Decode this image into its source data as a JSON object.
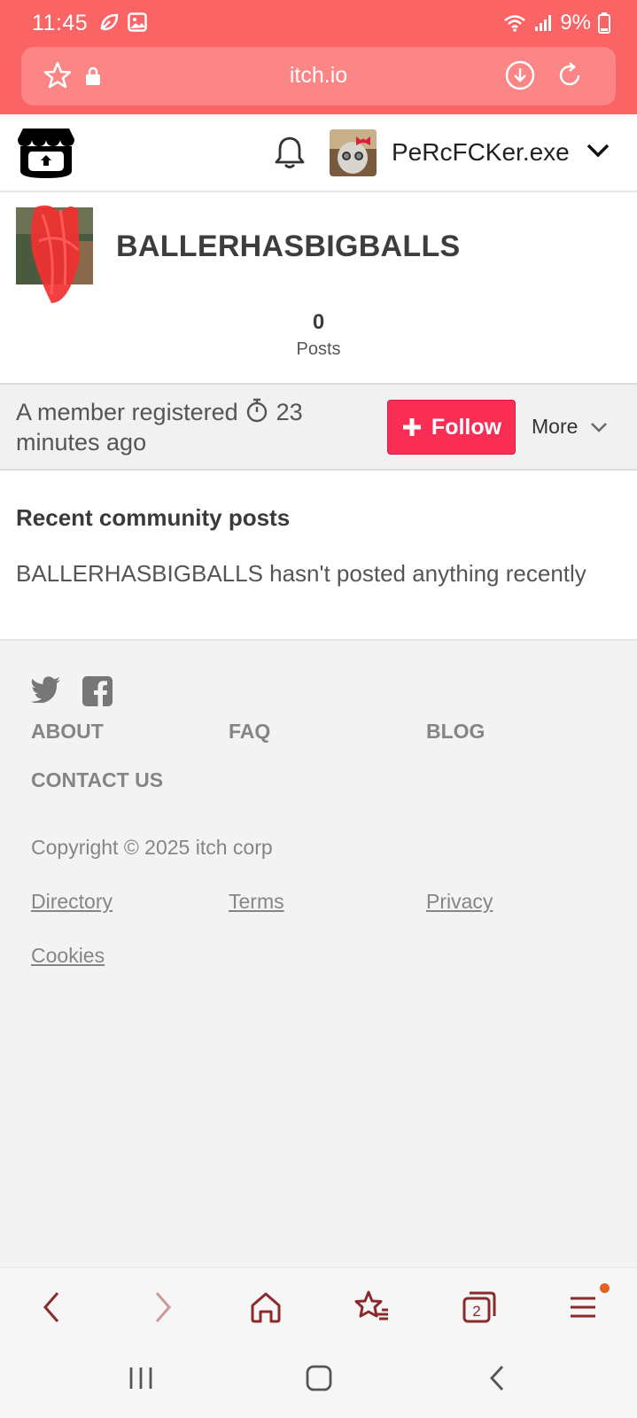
{
  "status": {
    "time": "11:45",
    "battery": "9%"
  },
  "browser": {
    "url": "itch.io"
  },
  "header": {
    "username": "PeRcFCKer.exe"
  },
  "profile": {
    "name": "BALLERHASBIGBALLS",
    "posts_count": "0",
    "posts_label": "Posts"
  },
  "member": {
    "text_a": "A member registered",
    "text_b": "23",
    "text_c": "minutes ago",
    "follow_label": "Follow",
    "more_label": "More"
  },
  "posts": {
    "heading": "Recent community posts",
    "empty_message": "BALLERHASBIGBALLS hasn't posted anything recently"
  },
  "footer": {
    "links": [
      "ABOUT",
      "FAQ",
      "BLOG",
      "CONTACT US"
    ],
    "copyright": "Copyright © 2025 itch corp",
    "sub_links": [
      "Directory",
      "Terms",
      "Privacy",
      "Cookies"
    ]
  },
  "colors": {
    "browser_accent": "#fa6464",
    "follow_button": "#fa2d55",
    "toolbar_icon": "#8a2a2a"
  },
  "toolbar": {
    "tabs_count": "2"
  }
}
